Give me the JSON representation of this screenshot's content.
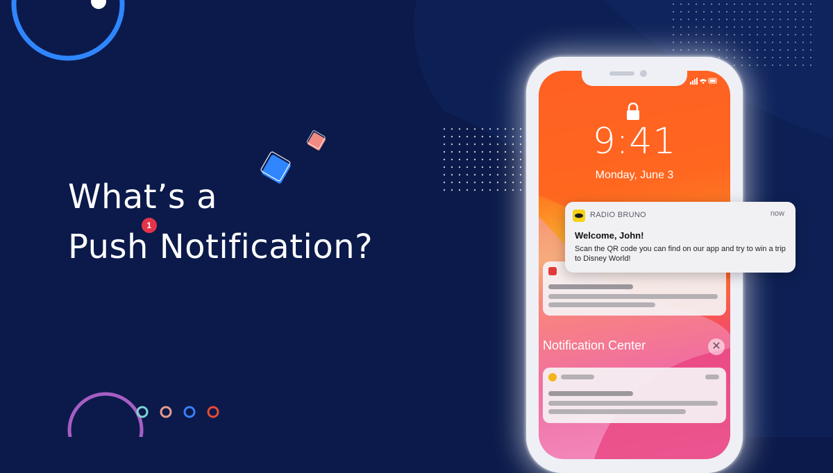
{
  "headline": {
    "line1": "What’s a",
    "line2_word1": "Push",
    "line2_word2": "Notification?",
    "badge_count": "1"
  },
  "phone": {
    "time": "9:41",
    "date": "Monday, June 3",
    "notification_center_label": "Notification Center",
    "close_symbol": "✕"
  },
  "notification": {
    "app_name": "RADIO BRUNO",
    "time": "now",
    "title": "Welcome, John!",
    "body": "Scan the QR code you can find on our app and try to win a trip to Disney World!"
  },
  "colors": {
    "background": "#0b1a4a",
    "accent_blue": "#2f86ff",
    "badge_red": "#e3344a",
    "accent_purple": "#a65ec4"
  },
  "icons": [
    "lock-icon",
    "signal-icon",
    "wifi-icon",
    "battery-icon",
    "close-icon",
    "radio-bruno-logo-icon"
  ]
}
